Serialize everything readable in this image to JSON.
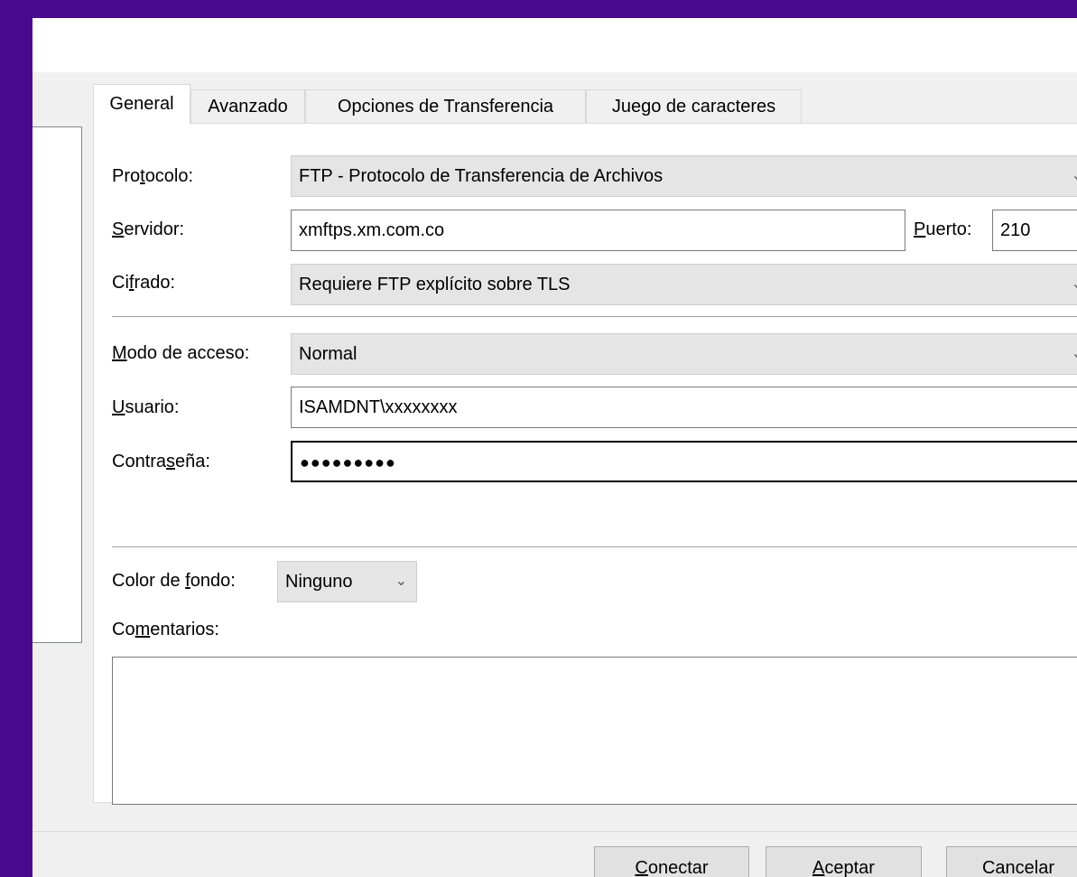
{
  "tabs": [
    "General",
    "Avanzado",
    "Opciones de Transferencia",
    "Juego de caracteres"
  ],
  "general": {
    "protocol": {
      "label_pre": "Pro",
      "label_u": "t",
      "label_post": "ocolo:",
      "value": "FTP - Protocolo de Transferencia de Archivos"
    },
    "server": {
      "label_pre": "",
      "label_u": "S",
      "label_post": "ervidor:",
      "value": "xmftps.xm.com.co"
    },
    "port": {
      "label_pre": "",
      "label_u": "P",
      "label_post": "uerto:",
      "value": "210"
    },
    "encryption": {
      "label_pre": "Ci",
      "label_u": "f",
      "label_post": "rado:",
      "value": "Requiere FTP explícito sobre TLS"
    },
    "access_mode": {
      "label_pre": "",
      "label_u": "M",
      "label_post": "odo de acceso:",
      "value": "Normal"
    },
    "user": {
      "label_pre": "",
      "label_u": "U",
      "label_post": "suario:",
      "value": "ISAMDNT\\xxxxxxxx"
    },
    "password": {
      "label_pre": "Contra",
      "label_u": "s",
      "label_post": "eña:",
      "value": "●●●●●●●●●"
    },
    "bg_color": {
      "label_pre": "Color de ",
      "label_u": "f",
      "label_post": "ondo:",
      "value": "Ninguno"
    },
    "comments": {
      "label_pre": "Co",
      "label_u": "m",
      "label_post": "entarios:"
    }
  },
  "buttons": {
    "connect": {
      "u": "C",
      "rest": "onectar"
    },
    "accept": {
      "u": "A",
      "rest": "ceptar"
    },
    "cancel": {
      "u": "",
      "rest": "Cancelar"
    }
  },
  "icons": {
    "dropdown": "chevron-down-icon",
    "scroll_up": "chevron-up-icon",
    "scroll_down": "chevron-down-icon"
  },
  "colors": {
    "backdrop": "#4a0a8f",
    "dialog": "#f0f0f0",
    "field_bg": "#ffffff",
    "combo_bg": "#e5e5e5"
  }
}
